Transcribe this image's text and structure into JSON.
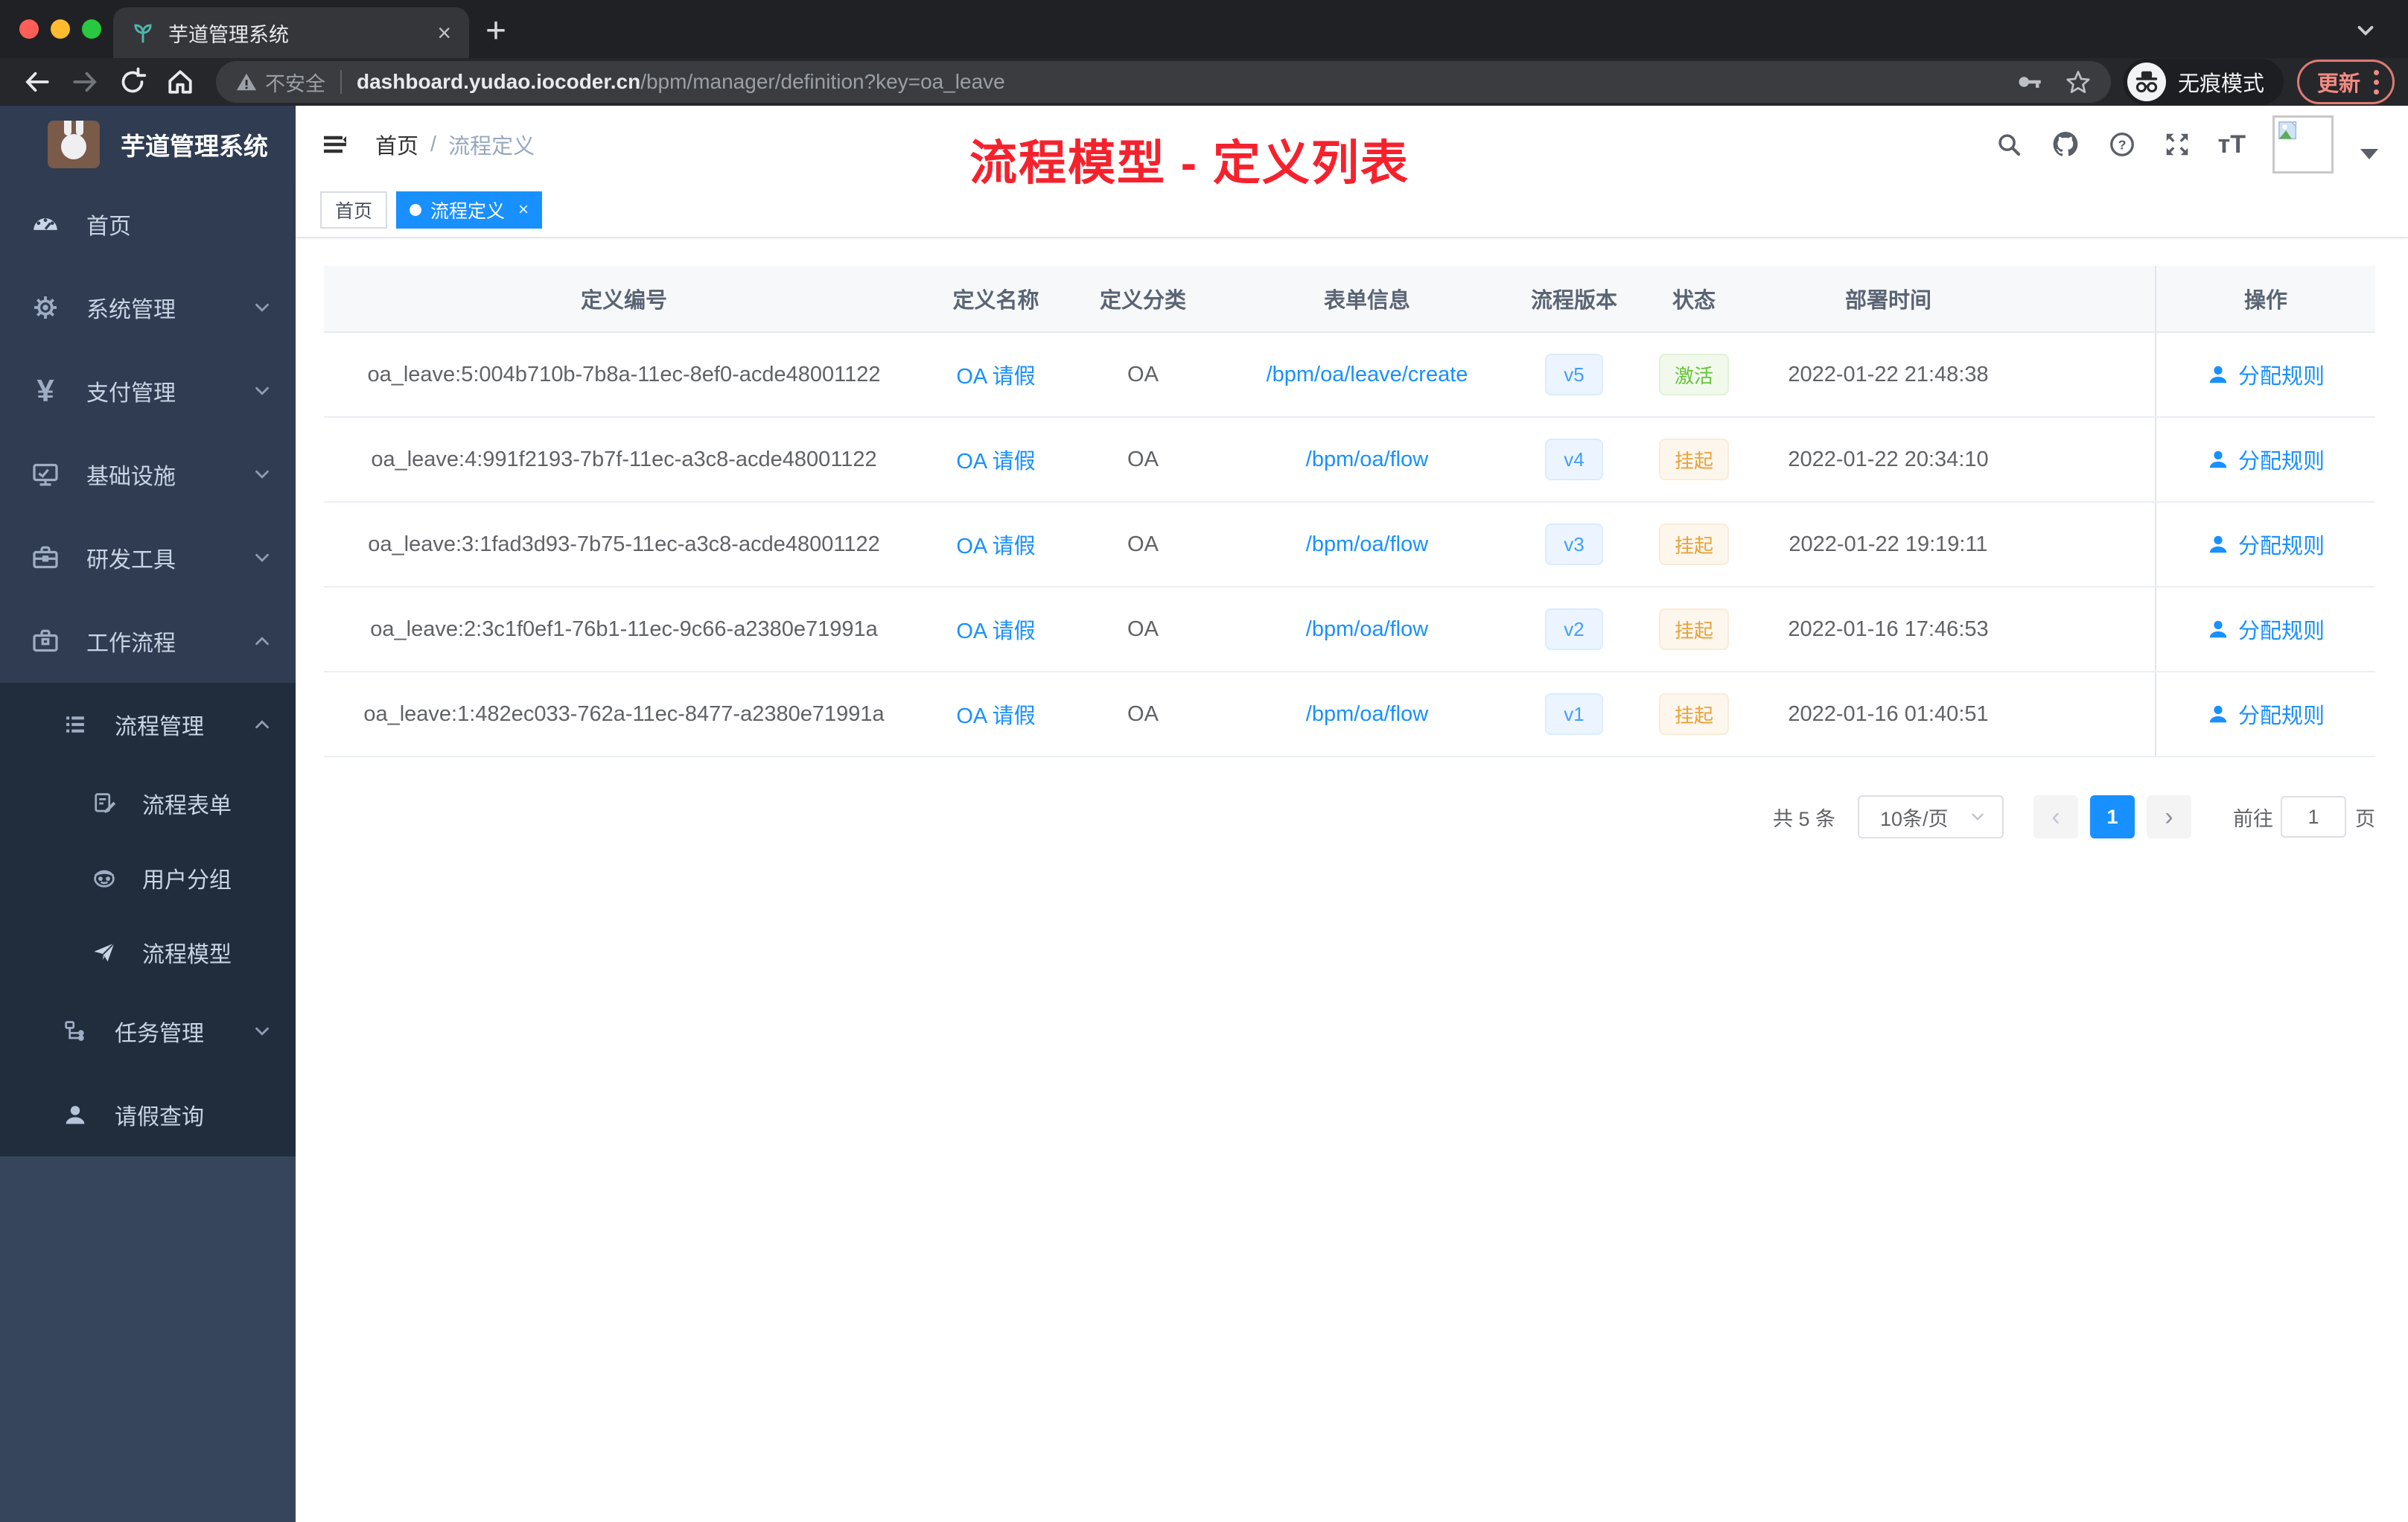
{
  "browser": {
    "tab_title": "芋道管理系统",
    "close_tab": "×",
    "new_tab": "+",
    "security_label": "不安全",
    "url_host": "dashboard.yudao.iocoder.cn",
    "url_path": "/bpm/manager/definition?key=oa_leave",
    "incognito_label": "无痕模式",
    "update_label": "更新"
  },
  "sidebar": {
    "brand": "芋道管理系统",
    "menu": [
      {
        "label": "首页",
        "icon": "dashboard-icon"
      },
      {
        "label": "系统管理",
        "icon": "gear-icon"
      },
      {
        "label": "支付管理",
        "icon": "yen-icon"
      },
      {
        "label": "基础设施",
        "icon": "monitor-icon"
      },
      {
        "label": "研发工具",
        "icon": "toolbox-icon"
      },
      {
        "label": "工作流程",
        "icon": "briefcase-icon"
      },
      {
        "label": "流程管理",
        "icon": "list-icon"
      },
      {
        "label": "流程表单",
        "icon": "form-icon"
      },
      {
        "label": "用户分组",
        "icon": "robot-icon"
      },
      {
        "label": "流程模型",
        "icon": "send-icon"
      },
      {
        "label": "任务管理",
        "icon": "tree-icon"
      },
      {
        "label": "请假查询",
        "icon": "user-icon"
      }
    ]
  },
  "header": {
    "breadcrumb": {
      "home": "首页",
      "sep": "/",
      "current": "流程定义"
    },
    "annotation": "流程模型 - 定义列表"
  },
  "tags": {
    "home": "首页",
    "active": "流程定义",
    "close": "×"
  },
  "table": {
    "columns": [
      "定义编号",
      "定义名称",
      "定义分类",
      "表单信息",
      "流程版本",
      "状态",
      "部署时间",
      "操作"
    ],
    "rows": [
      {
        "id": "oa_leave:5:004b710b-7b8a-11ec-8ef0-acde48001122",
        "name": "OA 请假",
        "category": "OA",
        "form": "/bpm/oa/leave/create",
        "version": "v5",
        "status": "激活",
        "status_type": "success",
        "deployed": "2022-01-22 21:48:38",
        "action": "分配规则"
      },
      {
        "id": "oa_leave:4:991f2193-7b7f-11ec-a3c8-acde48001122",
        "name": "OA 请假",
        "category": "OA",
        "form": "/bpm/oa/flow",
        "version": "v4",
        "status": "挂起",
        "status_type": "warning",
        "deployed": "2022-01-22 20:34:10",
        "action": "分配规则"
      },
      {
        "id": "oa_leave:3:1fad3d93-7b75-11ec-a3c8-acde48001122",
        "name": "OA 请假",
        "category": "OA",
        "form": "/bpm/oa/flow",
        "version": "v3",
        "status": "挂起",
        "status_type": "warning",
        "deployed": "2022-01-22 19:19:11",
        "action": "分配规则"
      },
      {
        "id": "oa_leave:2:3c1f0ef1-76b1-11ec-9c66-a2380e71991a",
        "name": "OA 请假",
        "category": "OA",
        "form": "/bpm/oa/flow",
        "version": "v2",
        "status": "挂起",
        "status_type": "warning",
        "deployed": "2022-01-16 17:46:53",
        "action": "分配规则"
      },
      {
        "id": "oa_leave:1:482ec033-762a-11ec-8477-a2380e71991a",
        "name": "OA 请假",
        "category": "OA",
        "form": "/bpm/oa/flow",
        "version": "v1",
        "status": "挂起",
        "status_type": "warning",
        "deployed": "2022-01-16 01:40:51",
        "action": "分配规则"
      }
    ]
  },
  "pagination": {
    "total": "共 5 条",
    "page_size": "10条/页",
    "prev": "‹",
    "current": "1",
    "next": "›",
    "goto": "前往",
    "goto_value": "1",
    "unit": "页"
  },
  "colors": {
    "primary": "#1890ff",
    "success": "#67c23a",
    "warning": "#e6a23c",
    "annotation": "#f5222d",
    "sidebar": "#2f3c52"
  }
}
